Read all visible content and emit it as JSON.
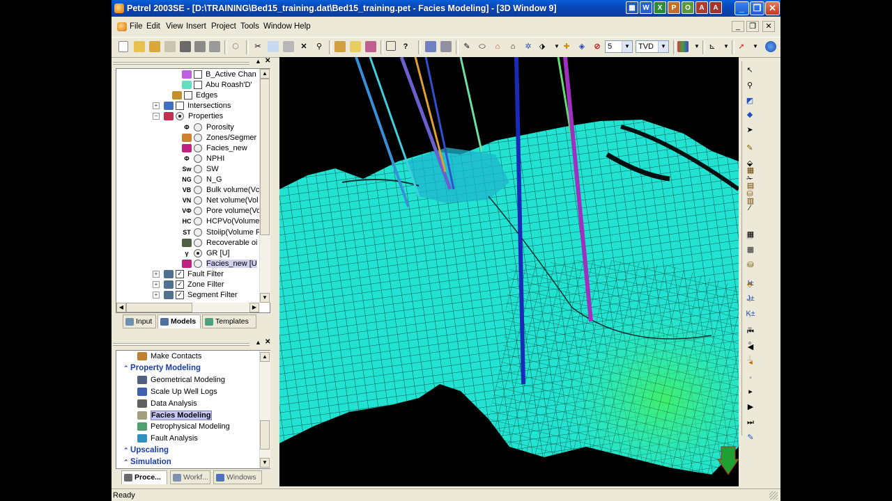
{
  "window": {
    "title": "Petrel 2003SE - [D:\\TRAINING\\Bed15_training.dat\\Bed15_training.pet - Facies Modeling] - [3D Window 9]"
  },
  "menu": [
    "File",
    "Edit",
    "View",
    "Insert",
    "Project",
    "Tools",
    "Window",
    "Help"
  ],
  "toolbar": {
    "combo_value": "5",
    "depth_domain": "TVD"
  },
  "tree": {
    "items": [
      {
        "label": "B_Active Chan",
        "kind": "checkbox",
        "checked": false,
        "color": "#c060e0"
      },
      {
        "label": "Abu Roash'D'",
        "kind": "checkbox",
        "checked": false,
        "color": "#60e0c0"
      },
      {
        "label": "Edges",
        "kind": "checkbox",
        "checked": false,
        "color": "#c09030"
      },
      {
        "label": "Intersections",
        "kind": "checkbox",
        "checked": false,
        "color": "#4070c0"
      },
      {
        "label": "Properties",
        "kind": "radio",
        "checked": true,
        "color": "#c03050"
      },
      {
        "label": "Porosity",
        "kind": "radio",
        "checked": false,
        "glyph": "Φ"
      },
      {
        "label": "Zones/Segmer",
        "kind": "radio",
        "checked": false,
        "color": "#d08030"
      },
      {
        "label": "Facies_new",
        "kind": "radio",
        "checked": false,
        "color": "#c02080"
      },
      {
        "label": "NPHI",
        "kind": "radio",
        "checked": false,
        "glyph": "Φ"
      },
      {
        "label": "SW",
        "kind": "radio",
        "checked": false,
        "glyph": "Sw"
      },
      {
        "label": "N_G",
        "kind": "radio",
        "checked": false,
        "glyph": "NG"
      },
      {
        "label": "Bulk volume(Vc",
        "kind": "radio",
        "checked": false,
        "glyph": "VB"
      },
      {
        "label": "Net volume(Vol",
        "kind": "radio",
        "checked": false,
        "glyph": "VN"
      },
      {
        "label": "Pore volume(Vo",
        "kind": "radio",
        "checked": false,
        "glyph": "VΦ"
      },
      {
        "label": "HCPVo(Volume",
        "kind": "radio",
        "checked": false,
        "glyph": "HC"
      },
      {
        "label": "Stoiip(Volume F",
        "kind": "radio",
        "checked": false,
        "glyph": "ST"
      },
      {
        "label": "Recoverable oi",
        "kind": "radio",
        "checked": false,
        "color": "#506040"
      },
      {
        "label": "GR [U]",
        "kind": "radio",
        "checked": true,
        "glyph": "γ"
      },
      {
        "label": "Facies_new [U",
        "kind": "radio",
        "checked": false,
        "color": "#c02080",
        "selected": true
      },
      {
        "label": "Fault Filter",
        "kind": "checkbox",
        "checked": true,
        "color": "#507090"
      },
      {
        "label": "Zone Filter",
        "kind": "checkbox",
        "checked": true,
        "color": "#507090"
      },
      {
        "label": "Segment Filter",
        "kind": "checkbox",
        "checked": true,
        "color": "#507090"
      }
    ],
    "tabs": [
      "Input",
      "Models",
      "Templates"
    ]
  },
  "process": {
    "items": [
      {
        "label": "Make Contacts",
        "type": "item"
      },
      {
        "label": "Property Modeling",
        "type": "head"
      },
      {
        "label": "Geometrical Modeling",
        "type": "item"
      },
      {
        "label": "Scale Up Well Logs",
        "type": "item"
      },
      {
        "label": "Data Analysis",
        "type": "item"
      },
      {
        "label": "Facies Modeling",
        "type": "item",
        "selected": true
      },
      {
        "label": "Petrophysical Modeling",
        "type": "item"
      },
      {
        "label": "Fault Analysis",
        "type": "item"
      },
      {
        "label": "Upscaling",
        "type": "head"
      },
      {
        "label": "Simulation",
        "type": "head"
      }
    ],
    "tabs": [
      "Proce...",
      "Workf...",
      "Windows"
    ]
  },
  "status": {
    "text": "Ready"
  },
  "colors": {
    "accent": "#0a5fd8",
    "surface": "#20e6d2",
    "surface_green": "#3fe070"
  }
}
